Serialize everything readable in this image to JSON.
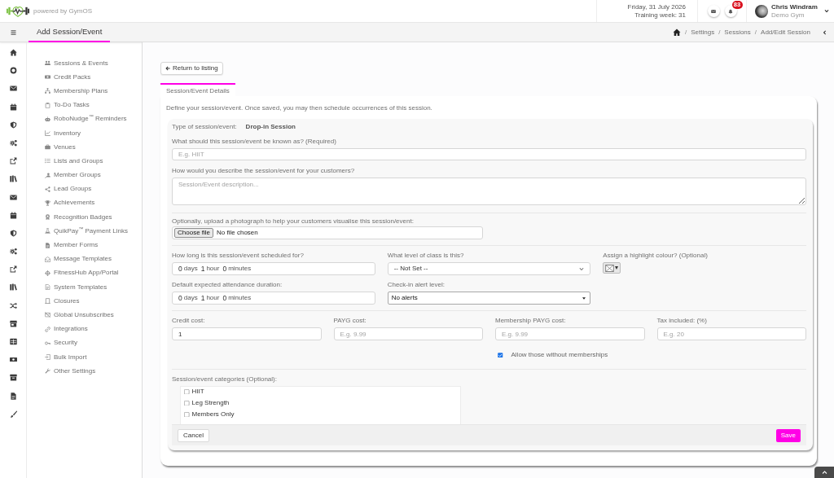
{
  "header": {
    "tagline": "powered by GymOS",
    "date": "Friday, 31 July 2026",
    "training_week": "Training week: 31",
    "notification_count": "83",
    "user": {
      "name": "Chris Windram",
      "gym": "Demo Gym"
    }
  },
  "title_bar": {
    "title": "Add Session/Event",
    "breadcrumb": {
      "separator": "/",
      "items": [
        "Settings",
        "Sessions",
        "Add/Edit Session"
      ]
    }
  },
  "settings_menu": {
    "items": [
      {
        "label": "Sessions & Events"
      },
      {
        "label": "Credit Packs"
      },
      {
        "label": "Membership Plans"
      },
      {
        "label": "To-Do Tasks"
      },
      {
        "label": "RoboNudge$^{™}$ Reminders"
      },
      {
        "label": "Inventory"
      },
      {
        "label": "Venues"
      },
      {
        "label": "Lists and Groups"
      },
      {
        "label": "Member Groups"
      },
      {
        "label": "Lead Groups"
      },
      {
        "label": "Achievements"
      },
      {
        "label": "Recognition Badges"
      },
      {
        "label": "QuikPay$^{™}$ Payment Links"
      },
      {
        "label": "Member Forms"
      },
      {
        "label": "Message Templates"
      },
      {
        "label": "FitnessHub App/Portal"
      },
      {
        "label": "System Templates"
      },
      {
        "label": "Closures"
      },
      {
        "label": "Global Unsubscribes"
      },
      {
        "label": "Integrations"
      },
      {
        "label": "Security"
      },
      {
        "label": "Bulk Import"
      },
      {
        "label": "Other Settings"
      }
    ]
  },
  "return_button": "Return to listing",
  "tabs": [
    {
      "label": "Session/Event Details",
      "selected": true
    }
  ],
  "intro": "Define your session/event. Once saved, you may then schedule occurrences of this session.",
  "session_type": {
    "label": "Type of session/event:",
    "value": "Drop-in Session"
  },
  "name_field": {
    "label": "What should this session/event be known as? (Required)",
    "placeholder": "E.g. HIIT"
  },
  "description_field": {
    "label": "How would you describe the session/event for your customers?",
    "placeholder": "Session/Event description..."
  },
  "photo_upload": {
    "label": "Optionally, upload a photograph to help your customers visualise this session/event:",
    "button": "Choose file",
    "status": "No file chosen"
  },
  "timing_columns": [
    [
      {
        "kind": "duration",
        "label": "How long is this session/event scheduled for?",
        "parts": [
          {
            "value": "0",
            "unit": "days"
          },
          {
            "value": "1",
            "unit": "hour"
          },
          {
            "value": "0",
            "unit": "minutes"
          }
        ]
      },
      {
        "kind": "duration",
        "label": "Default expected attendance duration:",
        "parts": [
          {
            "value": "0",
            "unit": "days"
          },
          {
            "value": "1",
            "unit": "hour"
          },
          {
            "value": "0",
            "unit": "minutes"
          }
        ]
      }
    ],
    [
      {
        "kind": "select",
        "label": "What level of class is this?",
        "value": "-- Not Set --"
      },
      {
        "kind": "native-select",
        "label": "Check-in alert level:",
        "value": "No alerts"
      }
    ],
    [
      {
        "kind": "colour",
        "label": "Assign a highlight colour? (Optional)",
        "caret": "▾"
      }
    ]
  ],
  "costs": [
    {
      "label": "Credit cost:",
      "value": "1"
    },
    {
      "label": "PAYG cost:",
      "placeholder": "E.g. 9.99"
    },
    {
      "label": "Membership PAYG cost:",
      "placeholder": "E.g. 9.99"
    },
    {
      "label": "Tax included: (%)",
      "placeholder": "E.g. 20"
    }
  ],
  "allow_without_membership": {
    "label": "Allow those without memberships",
    "checked": true
  },
  "categories": {
    "label": "Session/event categories (Optional):",
    "items": [
      {
        "label": "HIIT",
        "checked": false
      },
      {
        "label": "Leg Strength",
        "checked": false
      },
      {
        "label": "Members Only",
        "checked": false
      }
    ]
  },
  "buttons": [
    {
      "label": "Cancel",
      "kind": "secondary"
    },
    {
      "label": "Save",
      "kind": "primary"
    }
  ]
}
